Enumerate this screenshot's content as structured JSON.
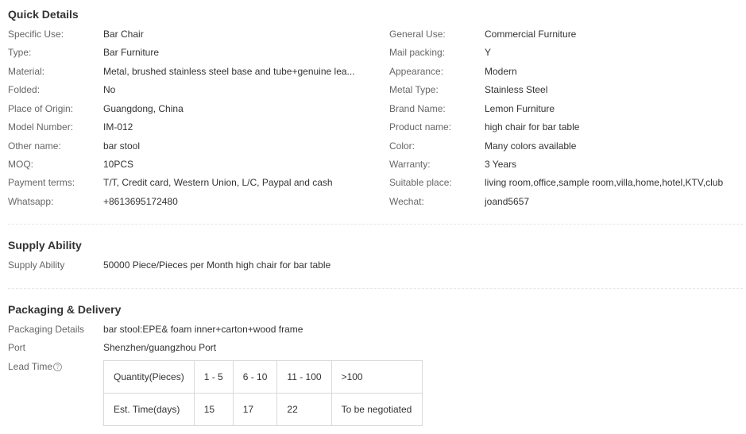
{
  "quick_details": {
    "title": "Quick Details",
    "left": [
      {
        "label": "Specific Use:",
        "value": "Bar Chair"
      },
      {
        "label": "Type:",
        "value": "Bar Furniture"
      },
      {
        "label": "Material:",
        "value": "Metal, brushed stainless steel base and tube+genuine lea..."
      },
      {
        "label": "Folded:",
        "value": "No"
      },
      {
        "label": "Place of Origin:",
        "value": "Guangdong, China"
      },
      {
        "label": "Model Number:",
        "value": "IM-012"
      },
      {
        "label": "Other name:",
        "value": "bar stool"
      },
      {
        "label": "MOQ:",
        "value": "10PCS"
      },
      {
        "label": "Payment terms:",
        "value": "T/T, Credit card, Western Union, L/C, Paypal and cash"
      },
      {
        "label": "Whatsapp:",
        "value": "+8613695172480"
      }
    ],
    "right": [
      {
        "label": "General Use:",
        "value": "Commercial Furniture"
      },
      {
        "label": "Mail packing:",
        "value": "Y"
      },
      {
        "label": "Appearance:",
        "value": "Modern"
      },
      {
        "label": "Metal Type:",
        "value": "Stainless Steel"
      },
      {
        "label": "Brand Name:",
        "value": "Lemon Furniture"
      },
      {
        "label": "Product name:",
        "value": "high chair for bar table"
      },
      {
        "label": "Color:",
        "value": "Many colors available"
      },
      {
        "label": "Warranty:",
        "value": "3 Years"
      },
      {
        "label": "Suitable place:",
        "value": "living room,office,sample room,villa,home,hotel,KTV,club"
      },
      {
        "label": "Wechat:",
        "value": "joand5657"
      }
    ]
  },
  "supply_ability": {
    "title": "Supply Ability",
    "label": "Supply Ability",
    "value": "50000 Piece/Pieces per Month high chair for bar table"
  },
  "packaging": {
    "title": "Packaging & Delivery",
    "details_label": "Packaging Details",
    "details_value": "bar stool:EPE& foam inner+carton+wood frame",
    "port_label": "Port",
    "port_value": "Shenzhen/guangzhou Port",
    "lead_label": "Lead Time",
    "help_glyph": "?",
    "lead_table": {
      "row1": [
        "Quantity(Pieces)",
        "1 - 5",
        "6 - 10",
        "11 - 100",
        ">100"
      ],
      "row2": [
        "Est. Time(days)",
        "15",
        "17",
        "22",
        "To be negotiated"
      ]
    }
  }
}
